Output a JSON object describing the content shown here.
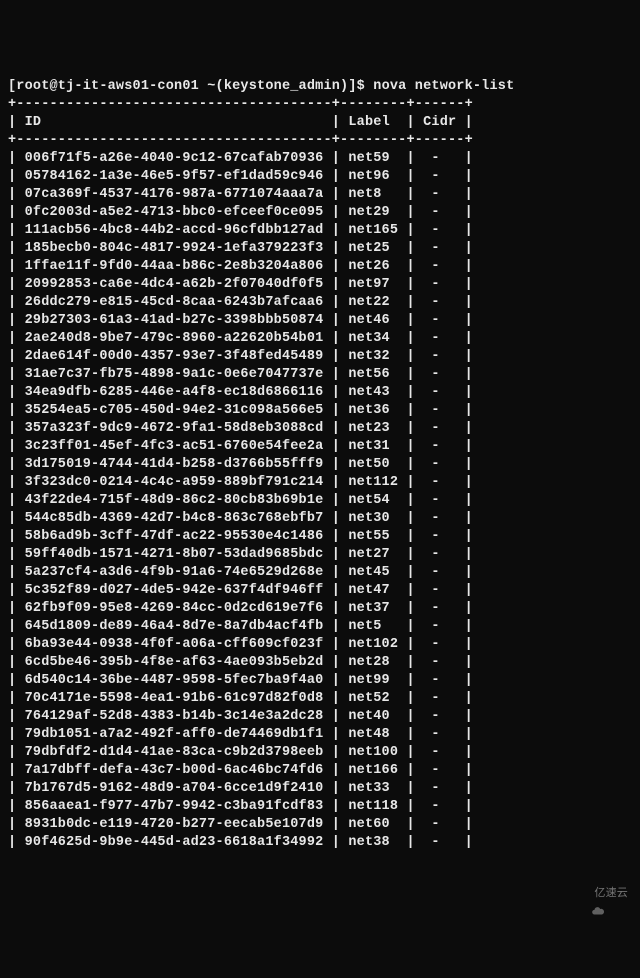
{
  "prompt": {
    "user_host": "[root@tj-it-aws01-con01 ~(keystone_admin)]$",
    "command": "nova network-list"
  },
  "headers": {
    "id": "ID",
    "label": "Label",
    "cidr": "Cidr"
  },
  "rows": [
    {
      "id": "006f71f5-a26e-4040-9c12-67cafab70936",
      "label": "net59",
      "cidr": "-"
    },
    {
      "id": "05784162-1a3e-46e5-9f57-ef1dad59c946",
      "label": "net96",
      "cidr": "-"
    },
    {
      "id": "07ca369f-4537-4176-987a-6771074aaa7a",
      "label": "net8",
      "cidr": "-"
    },
    {
      "id": "0fc2003d-a5e2-4713-bbc0-efceef0ce095",
      "label": "net29",
      "cidr": "-"
    },
    {
      "id": "111acb56-4bc8-44b2-accd-96cfdbb127ad",
      "label": "net165",
      "cidr": "-"
    },
    {
      "id": "185becb0-804c-4817-9924-1efa379223f3",
      "label": "net25",
      "cidr": "-"
    },
    {
      "id": "1ffae11f-9fd0-44aa-b86c-2e8b3204a806",
      "label": "net26",
      "cidr": "-"
    },
    {
      "id": "20992853-ca6e-4dc4-a62b-2f07040df0f5",
      "label": "net97",
      "cidr": "-"
    },
    {
      "id": "26ddc279-e815-45cd-8caa-6243b7afcaa6",
      "label": "net22",
      "cidr": "-"
    },
    {
      "id": "29b27303-61a3-41ad-b27c-3398bbb50874",
      "label": "net46",
      "cidr": "-"
    },
    {
      "id": "2ae240d8-9be7-479c-8960-a22620b54b01",
      "label": "net34",
      "cidr": "-"
    },
    {
      "id": "2dae614f-00d0-4357-93e7-3f48fed45489",
      "label": "net32",
      "cidr": "-"
    },
    {
      "id": "31ae7c37-fb75-4898-9a1c-0e6e7047737e",
      "label": "net56",
      "cidr": "-"
    },
    {
      "id": "34ea9dfb-6285-446e-a4f8-ec18d6866116",
      "label": "net43",
      "cidr": "-"
    },
    {
      "id": "35254ea5-c705-450d-94e2-31c098a566e5",
      "label": "net36",
      "cidr": "-"
    },
    {
      "id": "357a323f-9dc9-4672-9fa1-58d8eb3088cd",
      "label": "net23",
      "cidr": "-"
    },
    {
      "id": "3c23ff01-45ef-4fc3-ac51-6760e54fee2a",
      "label": "net31",
      "cidr": "-"
    },
    {
      "id": "3d175019-4744-41d4-b258-d3766b55fff9",
      "label": "net50",
      "cidr": "-"
    },
    {
      "id": "3f323dc0-0214-4c4c-a959-889bf791c214",
      "label": "net112",
      "cidr": "-"
    },
    {
      "id": "43f22de4-715f-48d9-86c2-80cb83b69b1e",
      "label": "net54",
      "cidr": "-"
    },
    {
      "id": "544c85db-4369-42d7-b4c8-863c768ebfb7",
      "label": "net30",
      "cidr": "-"
    },
    {
      "id": "58b6ad9b-3cff-47df-ac22-95530e4c1486",
      "label": "net55",
      "cidr": "-"
    },
    {
      "id": "59ff40db-1571-4271-8b07-53dad9685bdc",
      "label": "net27",
      "cidr": "-"
    },
    {
      "id": "5a237cf4-a3d6-4f9b-91a6-74e6529d268e",
      "label": "net45",
      "cidr": "-"
    },
    {
      "id": "5c352f89-d027-4de5-942e-637f4df946ff",
      "label": "net47",
      "cidr": "-"
    },
    {
      "id": "62fb9f09-95e8-4269-84cc-0d2cd619e7f6",
      "label": "net37",
      "cidr": "-"
    },
    {
      "id": "645d1809-de89-46a4-8d7e-8a7db4acf4fb",
      "label": "net5",
      "cidr": "-"
    },
    {
      "id": "6ba93e44-0938-4f0f-a06a-cff609cf023f",
      "label": "net102",
      "cidr": "-"
    },
    {
      "id": "6cd5be46-395b-4f8e-af63-4ae093b5eb2d",
      "label": "net28",
      "cidr": "-"
    },
    {
      "id": "6d540c14-36be-4487-9598-5fec7ba9f4a0",
      "label": "net99",
      "cidr": "-"
    },
    {
      "id": "70c4171e-5598-4ea1-91b6-61c97d82f0d8",
      "label": "net52",
      "cidr": "-"
    },
    {
      "id": "764129af-52d8-4383-b14b-3c14e3a2dc28",
      "label": "net40",
      "cidr": "-"
    },
    {
      "id": "79db1051-a7a2-492f-aff0-de74469db1f1",
      "label": "net48",
      "cidr": "-"
    },
    {
      "id": "79dbfdf2-d1d4-41ae-83ca-c9b2d3798eeb",
      "label": "net100",
      "cidr": "-"
    },
    {
      "id": "7a17dbff-defa-43c7-b00d-6ac46bc74fd6",
      "label": "net166",
      "cidr": "-"
    },
    {
      "id": "7b1767d5-9162-48d9-a704-6cce1d9f2410",
      "label": "net33",
      "cidr": "-"
    },
    {
      "id": "856aaea1-f977-47b7-9942-c3ba91fcdf83",
      "label": "net118",
      "cidr": "-"
    },
    {
      "id": "8931b0dc-e119-4720-b277-eecab5e107d9",
      "label": "net60",
      "cidr": "-"
    },
    {
      "id": "90f4625d-9b9e-445d-ad23-6618a1f34992",
      "label": "net38",
      "cidr": "-"
    }
  ],
  "watermark": "亿速云"
}
